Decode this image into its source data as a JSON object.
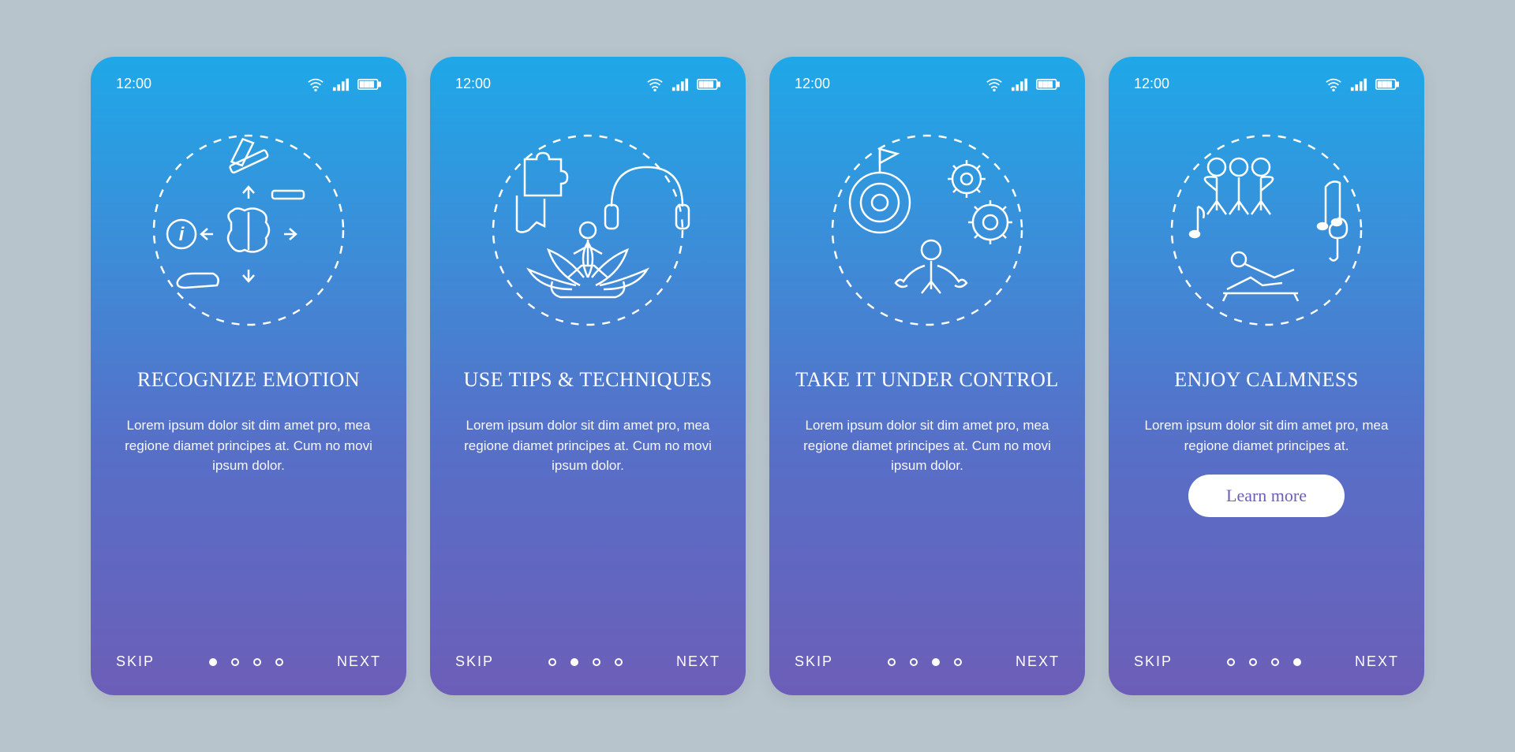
{
  "status": {
    "time": "12:00"
  },
  "screens": [
    {
      "title": "Recognize emotion",
      "description": "Lorem ipsum dolor sit dim amet pro, mea regione diamet principes at. Cum no movi ipsum dolor.",
      "skip": "SKIP",
      "next": "NEXT",
      "activeIndex": 0,
      "hasLearnMore": false
    },
    {
      "title": "Use tips & techniques",
      "description": "Lorem ipsum dolor sit dim amet pro, mea regione diamet principes at. Cum no movi ipsum dolor.",
      "skip": "SKIP",
      "next": "NEXT",
      "activeIndex": 1,
      "hasLearnMore": false
    },
    {
      "title": "Take it under control",
      "description": "Lorem ipsum dolor sit dim amet pro, mea regione diamet principes at. Cum no movi ipsum dolor.",
      "skip": "SKIP",
      "next": "NEXT",
      "activeIndex": 2,
      "hasLearnMore": false
    },
    {
      "title": "Enjoy calmness",
      "description": "Lorem ipsum dolor sit dim amet pro, mea regione diamet principes at.",
      "skip": "SKIP",
      "next": "NEXT",
      "activeIndex": 3,
      "hasLearnMore": true,
      "learnMore": "Learn more"
    }
  ]
}
